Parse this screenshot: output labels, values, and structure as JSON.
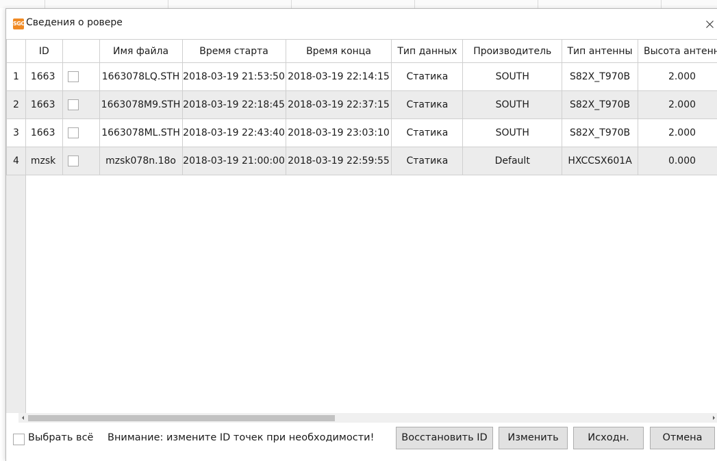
{
  "dialog": {
    "logo_text": "SGO",
    "title": "Сведения о ровере"
  },
  "table": {
    "columns": [
      "ID",
      "",
      "Имя файла",
      "Время старта",
      "Время конца",
      "Тип данных",
      "Производитель",
      "Тип антенны",
      "Высота антенн"
    ],
    "rows": [
      {
        "num": "1",
        "id": "1663",
        "file": "1663078LQ.STH",
        "start": "2018-03-19 21:53:50",
        "end": "2018-03-19 22:14:15",
        "type": "Статика",
        "maker": "SOUTH",
        "antenna": "S82X_T970B",
        "height": "2.000"
      },
      {
        "num": "2",
        "id": "1663",
        "file": "1663078M9.STH",
        "start": "2018-03-19 22:18:45",
        "end": "2018-03-19 22:37:15",
        "type": "Статика",
        "maker": "SOUTH",
        "antenna": "S82X_T970B",
        "height": "2.000"
      },
      {
        "num": "3",
        "id": "1663",
        "file": "1663078ML.STH",
        "start": "2018-03-19 22:43:40",
        "end": "2018-03-19 23:03:10",
        "type": "Статика",
        "maker": "SOUTH",
        "antenna": "S82X_T970B",
        "height": "2.000"
      },
      {
        "num": "4",
        "id": "mzsk",
        "file": "mzsk078n.18o",
        "start": "2018-03-19 21:00:00",
        "end": "2018-03-19 22:59:55",
        "type": "Статика",
        "maker": "Default",
        "antenna": "HXCCSX601A",
        "height": "0.000"
      }
    ]
  },
  "footer": {
    "select_all": "Выбрать всё",
    "warning": "Внимание: измените ID точек при необходимости!",
    "buttons": {
      "restore_id": "Восстановить ID",
      "edit": "Изменить",
      "original": "Исходн.",
      "cancel": "Отмена"
    }
  },
  "colors": {
    "logo": "#f08a24",
    "alt_row": "#ececec",
    "button": "#e1e1e1"
  }
}
